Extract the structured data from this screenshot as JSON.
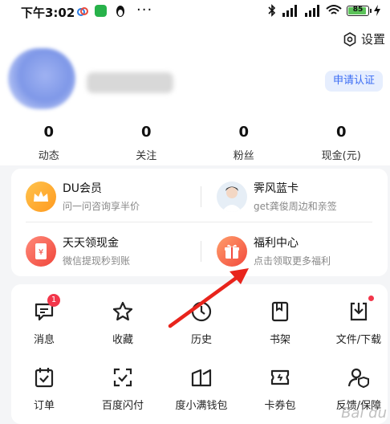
{
  "status_bar": {
    "time": "下午3:02",
    "battery": "85"
  },
  "header": {
    "settings_label": "设置",
    "verify_button": "申请认证"
  },
  "stats": [
    {
      "value": "0",
      "label": "动态"
    },
    {
      "value": "0",
      "label": "关注"
    },
    {
      "value": "0",
      "label": "粉丝"
    },
    {
      "value": "0",
      "label": "现金(元)"
    }
  ],
  "benefits": [
    {
      "title": "DU会员",
      "subtitle": "问一问咨询享半价",
      "icon": "crown-icon"
    },
    {
      "title": "霁风蓝卡",
      "subtitle": "get龚俊周边和亲签",
      "icon": "portrait-icon"
    },
    {
      "title": "天天领现金",
      "subtitle": "微信提现秒到账",
      "icon": "cash-icon"
    },
    {
      "title": "福利中心",
      "subtitle": "点击领取更多福利",
      "icon": "gift-icon"
    }
  ],
  "grid": [
    {
      "label": "消息",
      "icon": "message-icon",
      "badge": "1"
    },
    {
      "label": "收藏",
      "icon": "star-icon"
    },
    {
      "label": "历史",
      "icon": "clock-icon"
    },
    {
      "label": "书架",
      "icon": "bookshelf-icon"
    },
    {
      "label": "文件/下载",
      "icon": "download-icon"
    },
    {
      "label": "订单",
      "icon": "order-icon"
    },
    {
      "label": "百度闪付",
      "icon": "scan-pay-icon"
    },
    {
      "label": "度小满钱包",
      "icon": "wallet-icon"
    },
    {
      "label": "卡券包",
      "icon": "coupon-icon"
    },
    {
      "label": "反馈/保障",
      "icon": "feedback-icon"
    }
  ],
  "watermark": "Bai du"
}
